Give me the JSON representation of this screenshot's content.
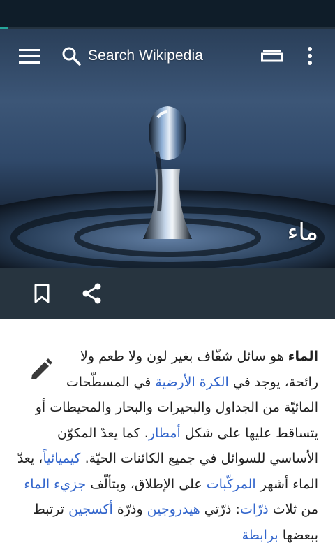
{
  "colors": {
    "status_bar": "#0f1d29",
    "progress_accent": "#26a69a",
    "action_bar": "#27343f",
    "link": "#3366cc",
    "text": "#222222"
  },
  "progress": {
    "fraction": 0.025
  },
  "toolbar": {
    "menu_icon": "hamburger-menu-icon",
    "search_icon": "magnifier-search-icon",
    "search_label": "Search Wikipedia",
    "tabs_icon": "tabs-icon",
    "overflow_icon": "vertical-dots-overflow-icon"
  },
  "hero": {
    "image": "water-drop-photo",
    "title": "ماء"
  },
  "actions": {
    "bookmark_icon": "bookmark-icon",
    "share_icon": "share-icon"
  },
  "article": {
    "edit_icon": "pencil-edit-icon",
    "lead": [
      {
        "t": "b",
        "text": "الماء"
      },
      {
        "t": "text",
        "text": " هو سائل شفّاف بغير لون ولا طعم ولا رائحة، يوجد في "
      },
      {
        "t": "link",
        "text": "الكرة الأرضية"
      },
      {
        "t": "text",
        "text": " في المسطّحات المائيّة من الجداول والبحيرات والبحار والمحيطات أو يتساقط عليها على شكل "
      },
      {
        "t": "link",
        "text": "أمطار"
      },
      {
        "t": "text",
        "text": ". كما يعدّ المكوّن الأساسي للسوائل في جميع الكائنات الحيّة. "
      },
      {
        "t": "link",
        "text": "كيميائياً"
      },
      {
        "t": "text",
        "text": "، يعدّ الماء أشهر "
      },
      {
        "t": "link",
        "text": "المركّبات"
      },
      {
        "t": "text",
        "text": " على الإطلاق، ويتألّف "
      },
      {
        "t": "link",
        "text": "جزيء الماء"
      },
      {
        "t": "text",
        "text": " من ثلاث "
      },
      {
        "t": "link",
        "text": "ذرّات"
      },
      {
        "t": "text",
        "text": ": ذرّتي "
      },
      {
        "t": "link",
        "text": "هيدروجين"
      },
      {
        "t": "text",
        "text": " وذرّة "
      },
      {
        "t": "link",
        "text": "أكسجين"
      },
      {
        "t": "text",
        "text": " ترتبط ببعضها "
      },
      {
        "t": "link",
        "text": "برابطة"
      }
    ]
  }
}
